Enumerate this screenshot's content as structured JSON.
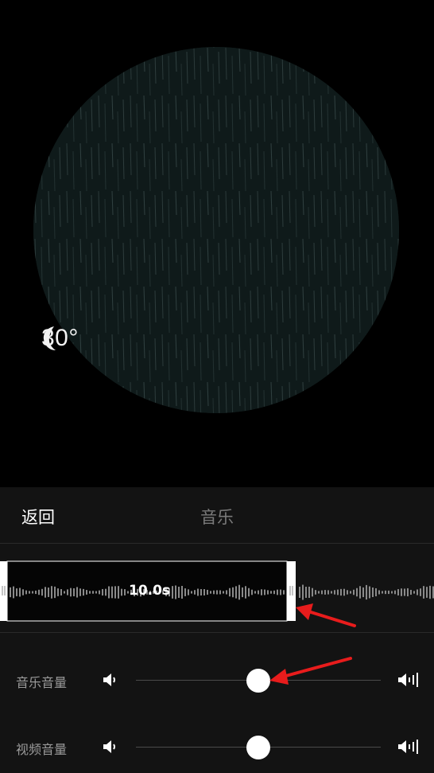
{
  "preview": {
    "weather_icon": "moon-icon",
    "temperature": "30°"
  },
  "panel": {
    "back_label": "返回",
    "title": "音乐"
  },
  "waveform": {
    "duration": "10.0s"
  },
  "sliders": [
    {
      "label": "音乐音量",
      "value": 0.5
    },
    {
      "label": "视频音量",
      "value": 0.5
    }
  ],
  "colors": {
    "background": "#000000",
    "panel": "#131313",
    "annotation_arrow": "#e81c1c"
  }
}
